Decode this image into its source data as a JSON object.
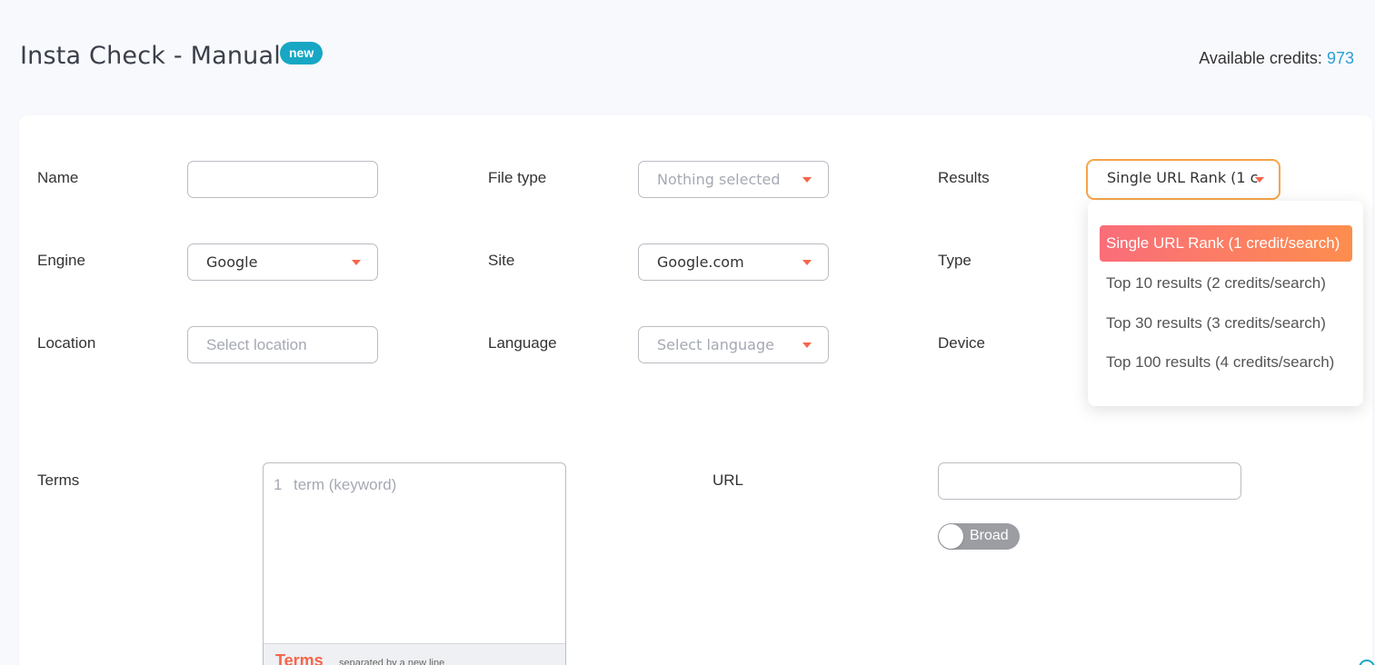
{
  "header": {
    "title": "Insta Check - Manual",
    "badge": "new",
    "credits_label": "Available credits:",
    "credits_value": "973"
  },
  "form": {
    "name": {
      "label": "Name",
      "value": ""
    },
    "file_type": {
      "label": "File type",
      "placeholder": "Nothing selected"
    },
    "results": {
      "label": "Results",
      "value": "Single URL Rank (1 c"
    },
    "engine": {
      "label": "Engine",
      "value": "Google"
    },
    "site": {
      "label": "Site",
      "value": "Google.com"
    },
    "type": {
      "label": "Type"
    },
    "location": {
      "label": "Location",
      "placeholder": "Select location"
    },
    "language": {
      "label": "Language",
      "placeholder": "Select language"
    },
    "device": {
      "label": "Device"
    },
    "terms": {
      "label": "Terms",
      "line_number": "1",
      "placeholder": "term (keyword)",
      "footer_title": "Terms",
      "footer_hint": "separated by a new line"
    },
    "url": {
      "label": "URL",
      "value": ""
    },
    "toggle": {
      "label": "Broad",
      "on": false
    }
  },
  "results_dropdown": {
    "options": [
      {
        "label": "Single URL Rank (1 credit/search)",
        "selected": true
      },
      {
        "label": "Top 10 results (2 credits/search)",
        "selected": false
      },
      {
        "label": "Top 30 results (3 credits/search)",
        "selected": false
      },
      {
        "label": "Top 100 results (4 credits/search)",
        "selected": false
      }
    ]
  },
  "colors": {
    "accent": "#f5664a",
    "badge": "#17a7c4",
    "credits": "#2a9fd6",
    "active_border": "#f5a54a"
  }
}
